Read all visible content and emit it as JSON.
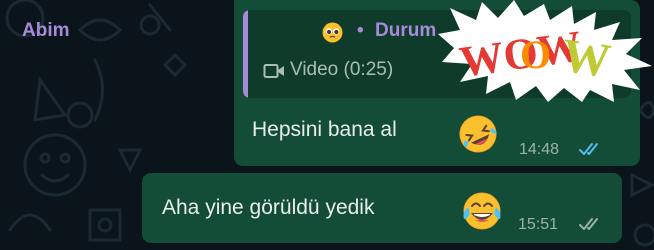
{
  "messages": [
    {
      "reply": {
        "author": "Abim",
        "separator": "•",
        "status_label": "Durum",
        "media_label": "Video (0:25)",
        "media_icon": "video-icon",
        "accent_color": "#a68cd8"
      },
      "sticker": {
        "text": "WOW",
        "icon": "wow-sticker"
      },
      "text": "Hepsini bana al",
      "emoji": "rolling-on-floor-laughing",
      "time": "14:48",
      "status": "read",
      "status_color": "#53bdeb"
    },
    {
      "text": "Aha yine görüldü yedik",
      "emoji": "tears-of-joy",
      "time": "15:51",
      "status": "delivered",
      "status_color": "#9ab3a7"
    }
  ],
  "colors": {
    "background": "#0b141a",
    "outgoing_bubble": "#144d37",
    "quote_background": "#0f3b2b"
  }
}
